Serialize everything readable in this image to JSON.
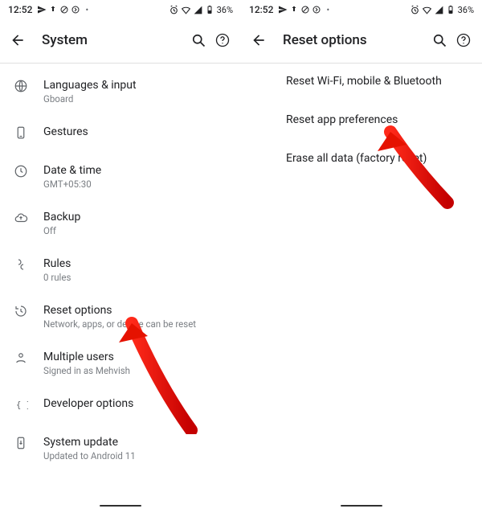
{
  "status": {
    "time": "12:52",
    "battery": "36%"
  },
  "left": {
    "title": "System",
    "items": [
      {
        "title": "Languages & input",
        "sub": "Gboard"
      },
      {
        "title": "Gestures",
        "sub": ""
      },
      {
        "title": "Date & time",
        "sub": "GMT+05:30"
      },
      {
        "title": "Backup",
        "sub": "Off"
      },
      {
        "title": "Rules",
        "sub": "0 rules"
      },
      {
        "title": "Reset options",
        "sub": "Network, apps, or device can be reset"
      },
      {
        "title": "Multiple users",
        "sub": "Signed in as Mehvish"
      },
      {
        "title": "Developer options",
        "sub": ""
      },
      {
        "title": "System update",
        "sub": "Updated to Android 11"
      }
    ]
  },
  "right": {
    "title": "Reset options",
    "options": [
      "Reset Wi-Fi, mobile & Bluetooth",
      "Reset app preferences",
      "Erase all data (factory reset)"
    ]
  }
}
